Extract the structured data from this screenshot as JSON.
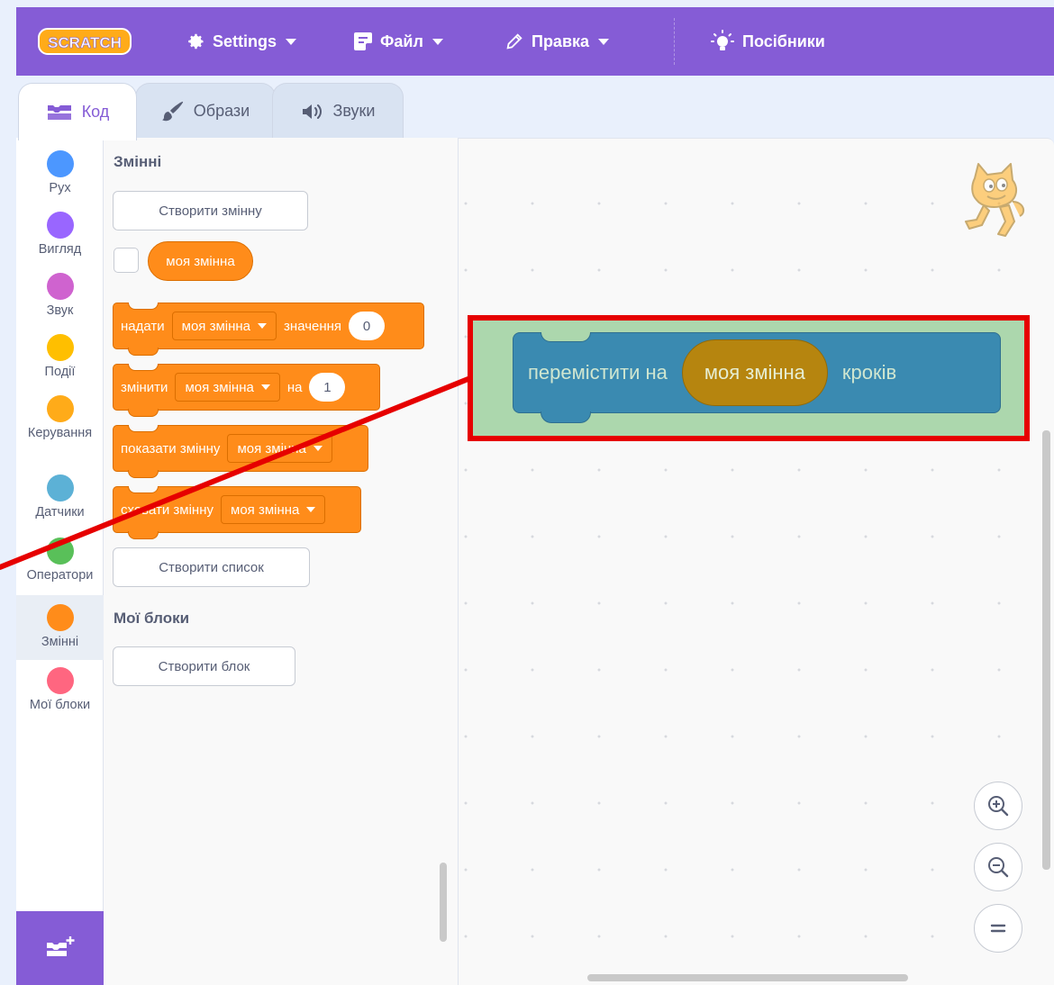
{
  "menu": {
    "logo_text": "SCRATCH",
    "settings": "Settings",
    "file": "Файл",
    "edit": "Правка",
    "tutorials": "Посібники"
  },
  "tabs": {
    "code": "Код",
    "costumes": "Образи",
    "sounds": "Звуки"
  },
  "categories": [
    {
      "label": "Рух",
      "color": "#4c97ff"
    },
    {
      "label": "Вигляд",
      "color": "#9966ff"
    },
    {
      "label": "Звук",
      "color": "#cf63cf"
    },
    {
      "label": "Події",
      "color": "#ffbf00"
    },
    {
      "label": "Керування",
      "color": "#ffab19"
    },
    {
      "label": "Датчики",
      "color": "#5cb1d6"
    },
    {
      "label": "Оператори",
      "color": "#59c059"
    },
    {
      "label": "Змінні",
      "color": "#ff8c1a"
    },
    {
      "label": "Мої блоки",
      "color": "#ff6680"
    }
  ],
  "palette": {
    "variables_title": "Змінні",
    "make_variable": "Створити змінну",
    "variable_reporter": "моя змінна",
    "set_block": {
      "prefix": "надати",
      "var": "моя змінна",
      "mid": "значення",
      "value": "0"
    },
    "change_block": {
      "prefix": "змінити",
      "var": "моя змінна",
      "mid": "на",
      "value": "1"
    },
    "show_block": {
      "prefix": "показати змінну",
      "var": "моя змінна"
    },
    "hide_block": {
      "prefix": "сховати змінну",
      "var": "моя змінна"
    },
    "make_list": "Створити список",
    "my_blocks_title": "Мої блоки",
    "make_block": "Створити блок"
  },
  "workspace": {
    "motion_block": {
      "prefix": "перемістити на",
      "var": "моя змінна",
      "suffix": "кроків"
    }
  },
  "zoom": {
    "zoom_in": "+",
    "zoom_out": "−",
    "reset": "="
  }
}
